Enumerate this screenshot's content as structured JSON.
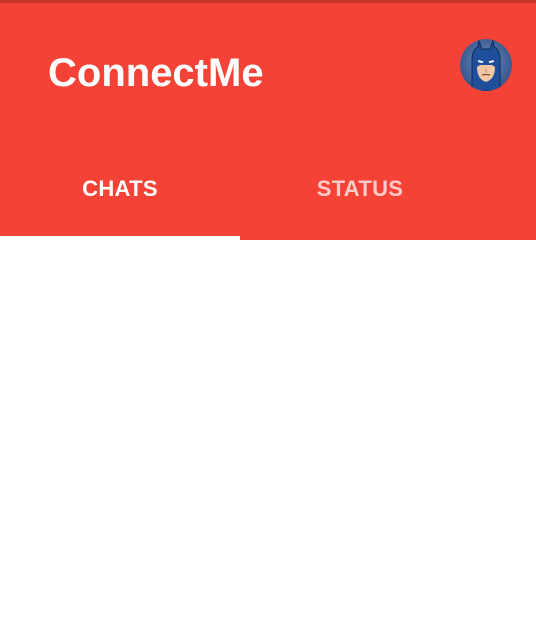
{
  "app": {
    "title": "ConnectMe",
    "avatar_icon": "batman-avatar-icon"
  },
  "colors": {
    "primary": "#f44336",
    "primary_dark": "#c8362b",
    "on_primary": "#ffffff"
  },
  "tabs": [
    {
      "label": "CHATS",
      "selected": true
    },
    {
      "label": "STATUS",
      "selected": false
    }
  ],
  "content": {}
}
